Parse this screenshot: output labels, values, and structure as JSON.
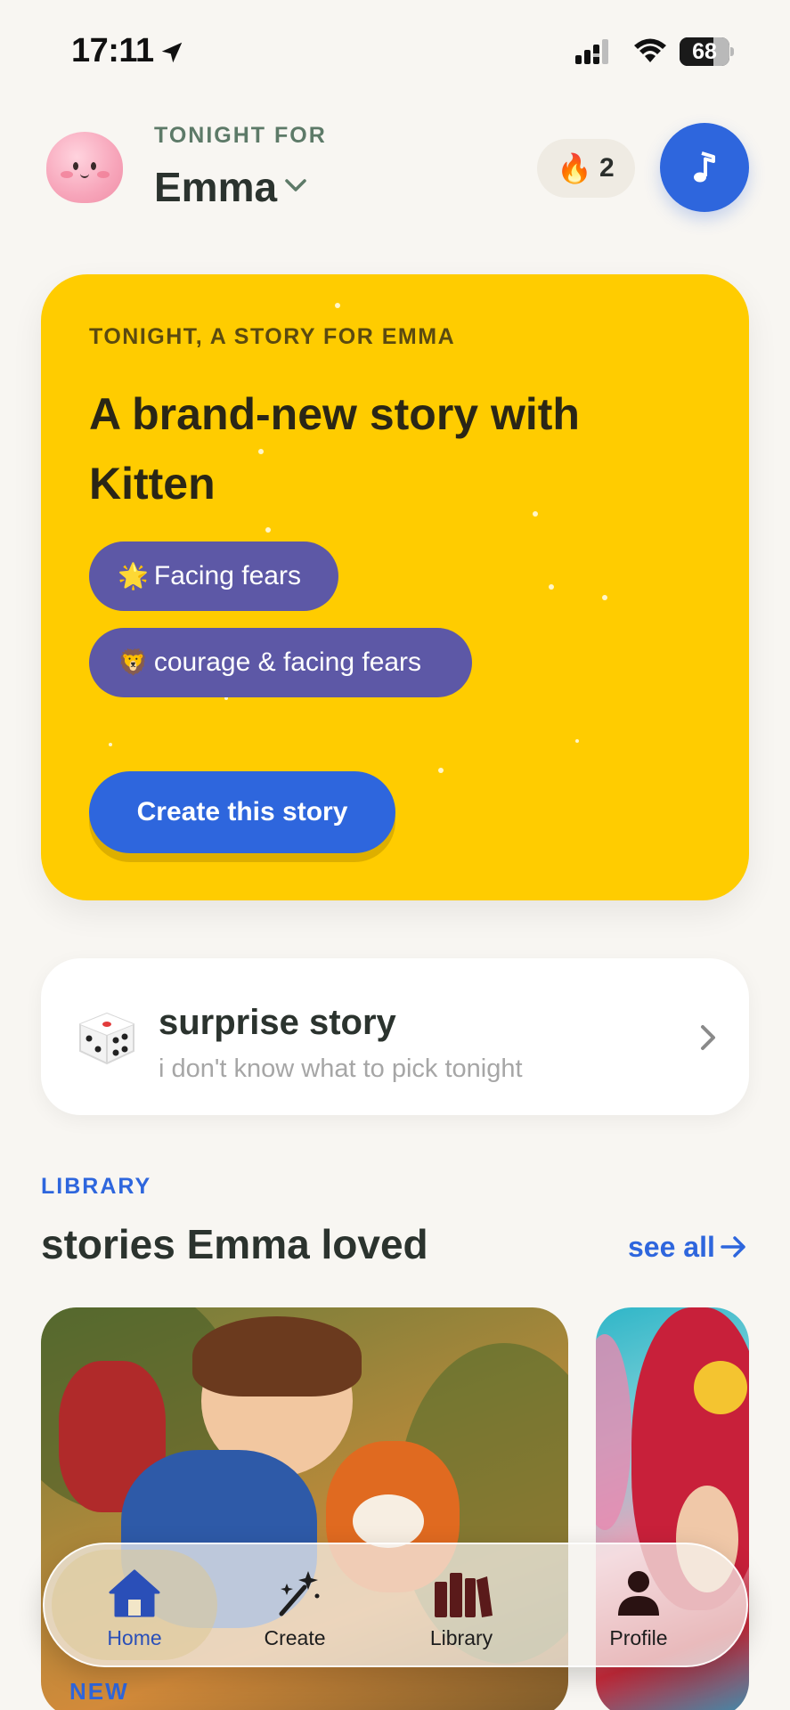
{
  "status_bar": {
    "time": "17:11",
    "battery": "68",
    "battery_level": 0.68
  },
  "header": {
    "kicker": "TONIGHT FOR",
    "name": "Emma",
    "streak_count": "2",
    "avatar_icon": "pink-blob-avatar",
    "music_icon": "music-note-icon"
  },
  "hero": {
    "kicker": "TONIGHT, A STORY FOR EMMA",
    "title": "A brand-new story with Kitten",
    "chips": [
      {
        "icon": "🌟",
        "label": "Facing fears"
      },
      {
        "icon": "🦁",
        "label": "courage & facing fears"
      }
    ],
    "cta": "Create this story",
    "background_color": "#ffcc00"
  },
  "surprise": {
    "title": "surprise story",
    "subtitle": "i don't know what to pick tonight",
    "icon": "dice-icon"
  },
  "library": {
    "label": "LIBRARY",
    "heading": "stories Emma loved",
    "see_all": "see all",
    "new_label": "NEW"
  },
  "tabs": [
    {
      "label": "Home",
      "icon": "home-icon",
      "active": true
    },
    {
      "label": "Create",
      "icon": "magic-wand-icon",
      "active": false
    },
    {
      "label": "Library",
      "icon": "books-icon",
      "active": false
    },
    {
      "label": "Profile",
      "icon": "person-icon",
      "active": false
    }
  ],
  "colors": {
    "accent": "#2e66dd",
    "chip": "#5d58a6",
    "background": "#f8f6f2"
  }
}
